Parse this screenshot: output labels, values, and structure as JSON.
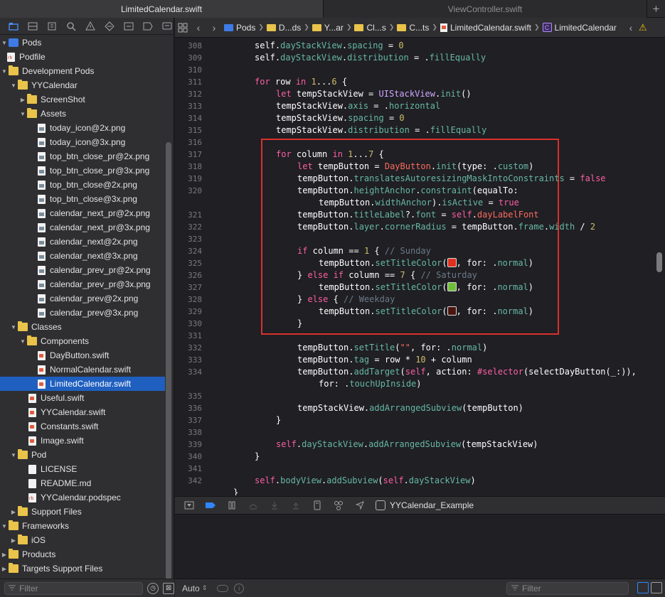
{
  "tabs": [
    {
      "label": "LimitedCalendar.swift",
      "active": true
    },
    {
      "label": "ViewController.swift",
      "active": false
    }
  ],
  "tab_add_symbol": "+",
  "navigator_icons": [
    "folder-icon",
    "source-control-icon",
    "symbol-icon",
    "search-icon",
    "warning-icon",
    "test-icon",
    "debug-icon",
    "breakpoint-icon",
    "report-icon"
  ],
  "file_tree": [
    {
      "label": "Pods",
      "type": "project",
      "indent": 0,
      "disclosure": "open"
    },
    {
      "label": "Podfile",
      "type": "rb",
      "indent": 0,
      "disclosure": ""
    },
    {
      "label": "Development Pods",
      "type": "folder",
      "indent": 0,
      "disclosure": "open"
    },
    {
      "label": "YYCalendar",
      "type": "folder",
      "indent": 1,
      "disclosure": "open"
    },
    {
      "label": "ScreenShot",
      "type": "folder",
      "indent": 2,
      "disclosure": "closed"
    },
    {
      "label": "Assets",
      "type": "folder",
      "indent": 2,
      "disclosure": "open"
    },
    {
      "label": "today_icon@2x.png",
      "type": "img",
      "indent": 3,
      "disclosure": ""
    },
    {
      "label": "today_icon@3x.png",
      "type": "img",
      "indent": 3,
      "disclosure": ""
    },
    {
      "label": "top_btn_close_pr@2x.png",
      "type": "img",
      "indent": 3,
      "disclosure": ""
    },
    {
      "label": "top_btn_close_pr@3x.png",
      "type": "img",
      "indent": 3,
      "disclosure": ""
    },
    {
      "label": "top_btn_close@2x.png",
      "type": "img",
      "indent": 3,
      "disclosure": ""
    },
    {
      "label": "top_btn_close@3x.png",
      "type": "img",
      "indent": 3,
      "disclosure": ""
    },
    {
      "label": "calendar_next_pr@2x.png",
      "type": "img",
      "indent": 3,
      "disclosure": ""
    },
    {
      "label": "calendar_next_pr@3x.png",
      "type": "img",
      "indent": 3,
      "disclosure": ""
    },
    {
      "label": "calendar_next@2x.png",
      "type": "img",
      "indent": 3,
      "disclosure": ""
    },
    {
      "label": "calendar_next@3x.png",
      "type": "img",
      "indent": 3,
      "disclosure": ""
    },
    {
      "label": "calendar_prev_pr@2x.png",
      "type": "img",
      "indent": 3,
      "disclosure": ""
    },
    {
      "label": "calendar_prev_pr@3x.png",
      "type": "img",
      "indent": 3,
      "disclosure": ""
    },
    {
      "label": "calendar_prev@2x.png",
      "type": "img",
      "indent": 3,
      "disclosure": ""
    },
    {
      "label": "calendar_prev@3x.png",
      "type": "img",
      "indent": 3,
      "disclosure": ""
    },
    {
      "label": "Classes",
      "type": "folder",
      "indent": 1,
      "disclosure": "open"
    },
    {
      "label": "Components",
      "type": "folder",
      "indent": 2,
      "disclosure": "open"
    },
    {
      "label": "DayButton.swift",
      "type": "swift",
      "indent": 3,
      "disclosure": ""
    },
    {
      "label": "NormalCalendar.swift",
      "type": "swift",
      "indent": 3,
      "disclosure": ""
    },
    {
      "label": "LimitedCalendar.swift",
      "type": "swift",
      "indent": 3,
      "disclosure": "",
      "selected": true
    },
    {
      "label": "Useful.swift",
      "type": "swift",
      "indent": 2,
      "disclosure": ""
    },
    {
      "label": "YYCalendar.swift",
      "type": "swift",
      "indent": 2,
      "disclosure": ""
    },
    {
      "label": "Constants.swift",
      "type": "swift",
      "indent": 2,
      "disclosure": ""
    },
    {
      "label": "Image.swift",
      "type": "swift",
      "indent": 2,
      "disclosure": ""
    },
    {
      "label": "Pod",
      "type": "folder",
      "indent": 1,
      "disclosure": "open"
    },
    {
      "label": "LICENSE",
      "type": "doc",
      "indent": 2,
      "disclosure": ""
    },
    {
      "label": "README.md",
      "type": "doc",
      "indent": 2,
      "disclosure": ""
    },
    {
      "label": "YYCalendar.podspec",
      "type": "rb",
      "indent": 2,
      "disclosure": ""
    },
    {
      "label": "Support Files",
      "type": "folder",
      "indent": 1,
      "disclosure": "closed"
    },
    {
      "label": "Frameworks",
      "type": "folder",
      "indent": 0,
      "disclosure": "open"
    },
    {
      "label": "iOS",
      "type": "folder",
      "indent": 1,
      "disclosure": "closed"
    },
    {
      "label": "Products",
      "type": "folder",
      "indent": 0,
      "disclosure": "closed"
    },
    {
      "label": "Targets Support Files",
      "type": "folder",
      "indent": 0,
      "disclosure": "closed"
    }
  ],
  "sidebar_filter": {
    "placeholder": "Filter"
  },
  "jumpbar": {
    "crumbs": [
      {
        "label": "Pods",
        "icon": "project"
      },
      {
        "label": "D...ds",
        "icon": "folder"
      },
      {
        "label": "Y...ar",
        "icon": "folder"
      },
      {
        "label": "Cl...s",
        "icon": "folder"
      },
      {
        "label": "C...ts",
        "icon": "folder"
      },
      {
        "label": "LimitedCalendar.swift",
        "icon": "swift"
      },
      {
        "label": "LimitedCalendar",
        "icon": "class"
      }
    ],
    "class_letter": "C"
  },
  "code_lines": [
    {
      "n": "308",
      "html": "<span>self</span>.<span class=\"prop\">dayStackView</span>.<span class=\"prop\">spacing</span> = <span class=\"num\">0</span>",
      "indent": 0
    },
    {
      "n": "309",
      "html": "self.<span class=\"prop\">dayStackView</span>.<span class=\"prop\">distribution</span> = .<span class=\"prop\">fillEqually</span>",
      "indent": 0
    },
    {
      "n": "310",
      "html": "",
      "indent": 0
    },
    {
      "n": "311",
      "html": "<span class=\"kw\">for</span> row <span class=\"kw\">in</span> <span class=\"num\">1</span>...<span class=\"num\">6</span> {",
      "indent": 0
    },
    {
      "n": "312",
      "html": "<span class=\"kw\">let</span> tempStackView = <span class=\"typ\">UIStackView</span>.<span class=\"fn\">init</span>()",
      "indent": 1
    },
    {
      "n": "313",
      "html": "tempStackView.<span class=\"prop\">axis</span> = .<span class=\"prop\">horizontal</span>",
      "indent": 1
    },
    {
      "n": "314",
      "html": "tempStackView.<span class=\"prop\">spacing</span> = <span class=\"num\">0</span>",
      "indent": 1
    },
    {
      "n": "315",
      "html": "tempStackView.<span class=\"prop\">distribution</span> = .<span class=\"prop\">fillEqually</span>",
      "indent": 1
    },
    {
      "n": "316",
      "html": "",
      "indent": 0
    },
    {
      "n": "317",
      "html": "<span class=\"kw\">for</span> column <span class=\"kw\">in</span> <span class=\"num\">1</span>...<span class=\"num\">7</span> {",
      "indent": 1
    },
    {
      "n": "318",
      "html": "<span class=\"kw\">let</span> tempButton = <span class=\"str\">DayButton</span>.<span class=\"fn\">init</span>(type: .<span class=\"prop\">custom</span>)",
      "indent": 2
    },
    {
      "n": "319",
      "html": "tempButton.<span class=\"prop\">translatesAutoresizingMaskIntoConstraints</span> = <span class=\"kw\">false</span>",
      "indent": 2
    },
    {
      "n": "320",
      "html": "tempButton.<span class=\"prop\">heightAnchor</span>.<span class=\"fn\">constraint</span>(equalTo:",
      "indent": 2
    },
    {
      "n": "",
      "html": "tempButton.<span class=\"prop\">widthAnchor</span>).<span class=\"prop\">isActive</span> = <span class=\"kw\">true</span>",
      "indent": 3
    },
    {
      "n": "321",
      "html": "tempButton.<span class=\"prop\">titleLabel</span>?.<span class=\"prop\">font</span> = <span class=\"kw\">self</span>.<span class=\"str\">dayLabelFont</span>",
      "indent": 2
    },
    {
      "n": "322",
      "html": "tempButton.<span class=\"prop\">layer</span>.<span class=\"prop\">cornerRadius</span> = tempButton.<span class=\"prop\">frame</span>.<span class=\"prop\">width</span> / <span class=\"num\">2</span>",
      "indent": 2
    },
    {
      "n": "323",
      "html": "",
      "indent": 0
    },
    {
      "n": "324",
      "html": "<span class=\"kw\">if</span> column == <span class=\"num\">1</span> { <span class=\"cmt\">// Sunday</span>",
      "indent": 2
    },
    {
      "n": "325",
      "html": "tempButton.<span class=\"fn\">setTitleColor</span>(<span class=\"sw\" style=\"background:#e0301f\"></span>, for: .<span class=\"prop\">normal</span>)",
      "indent": 3
    },
    {
      "n": "326",
      "html": "} <span class=\"kw\">else if</span> column == <span class=\"num\">7</span> { <span class=\"cmt\">// Saturday</span>",
      "indent": 2
    },
    {
      "n": "327",
      "html": "tempButton.<span class=\"fn\">setTitleColor</span>(<span class=\"sw\" style=\"background:#6fbe3b\"></span>, for: .<span class=\"prop\">normal</span>)",
      "indent": 3
    },
    {
      "n": "328",
      "html": "} <span class=\"kw\">else</span> { <span class=\"cmt\">// Weekday</span>",
      "indent": 2
    },
    {
      "n": "329",
      "html": "tempButton.<span class=\"fn\">setTitleColor</span>(<span class=\"sw\" style=\"background:#4a1610\"></span>, for: .<span class=\"prop\">normal</span>)",
      "indent": 3
    },
    {
      "n": "330",
      "html": "}",
      "indent": 2
    },
    {
      "n": "331",
      "html": "",
      "indent": 0
    },
    {
      "n": "332",
      "html": "tempButton.<span class=\"fn\">setTitle</span>(<span class=\"str\">\"\"</span>, for: .<span class=\"prop\">normal</span>)",
      "indent": 2
    },
    {
      "n": "333",
      "html": "tempButton.<span class=\"prop\">tag</span> = row * <span class=\"num\">10</span> + column",
      "indent": 2
    },
    {
      "n": "334",
      "html": "tempButton.<span class=\"fn\">addTarget</span>(<span class=\"kw\">self</span>, action: <span class=\"kw\">#selector</span>(selectDayButton(_:)),",
      "indent": 2
    },
    {
      "n": "",
      "html": "for: .<span class=\"prop\">touchUpInside</span>)",
      "indent": 3
    },
    {
      "n": "335",
      "html": "",
      "indent": 0
    },
    {
      "n": "336",
      "html": "tempStackView.<span class=\"fn\">addArrangedSubview</span>(tempButton)",
      "indent": 2
    },
    {
      "n": "337",
      "html": "}",
      "indent": 1
    },
    {
      "n": "338",
      "html": "",
      "indent": 0
    },
    {
      "n": "339",
      "html": "<span class=\"kw\">self</span>.<span class=\"prop\">dayStackView</span>.<span class=\"fn\">addArrangedSubview</span>(tempStackView)",
      "indent": 1
    },
    {
      "n": "340",
      "html": "}",
      "indent": 0
    },
    {
      "n": "341",
      "html": "",
      "indent": 0
    },
    {
      "n": "342",
      "html": "<span class=\"kw\">self</span>.<span class=\"prop\">bodyView</span>.<span class=\"fn\">addSubview</span>(<span class=\"kw\">self</span>.<span class=\"prop\">dayStackView</span>)",
      "indent": 0
    },
    {
      "n": "",
      "html": "}",
      "indent": -1
    }
  ],
  "swatch_colors": {
    "sunday": "#e0301f",
    "saturday": "#6fbe3b",
    "weekday": "#4a1610"
  },
  "debugbar": {
    "target": "YYCalendar_Example"
  },
  "console_bar": {
    "mode": "Auto",
    "filter_placeholder": "Filter"
  },
  "colors": {
    "accent": "#1f5fbf",
    "highlight_box": "#d9302b"
  }
}
